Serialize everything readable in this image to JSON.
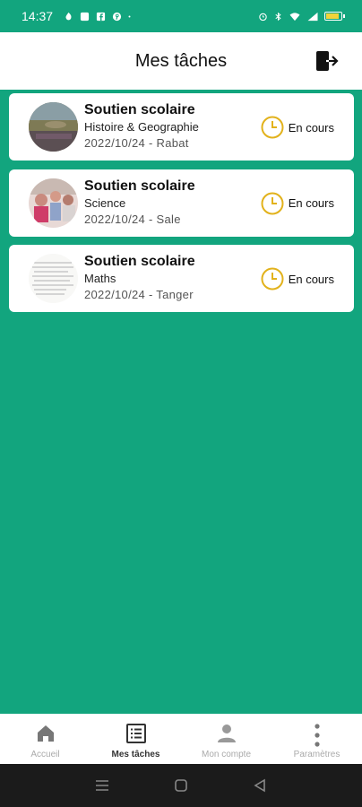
{
  "status_bar": {
    "time": "14:37",
    "left_icons": [
      "tinder-icon",
      "square-app-icon",
      "facebook-icon",
      "pinterest-icon",
      "dot-icon"
    ],
    "right_icons": [
      "alarm-icon",
      "bluetooth-icon",
      "wifi-icon",
      "signal-icon",
      "battery-icon"
    ]
  },
  "header": {
    "title": "Mes tâches"
  },
  "tasks": [
    {
      "title": "Soutien scolaire",
      "subject": "Histoire & Geographie",
      "meta": "2022/10/24 - Rabat",
      "status": "En cours"
    },
    {
      "title": "Soutien scolaire",
      "subject": "Science",
      "meta": "2022/10/24 - Sale",
      "status": "En cours"
    },
    {
      "title": "Soutien scolaire",
      "subject": "Maths",
      "meta": "2022/10/24 - Tanger",
      "status": "En cours"
    }
  ],
  "bottom_nav": {
    "items": [
      {
        "label": "Accueil",
        "icon": "home-icon"
      },
      {
        "label": "Mes tâches",
        "icon": "task-list-icon"
      },
      {
        "label": "Mon compte",
        "icon": "person-icon"
      },
      {
        "label": "Paramètres",
        "icon": "more-vertical-icon"
      }
    ],
    "active_index": 1
  },
  "colors": {
    "background": "#12a57e",
    "status_accent": "#e2b21c",
    "card": "#ffffff"
  }
}
